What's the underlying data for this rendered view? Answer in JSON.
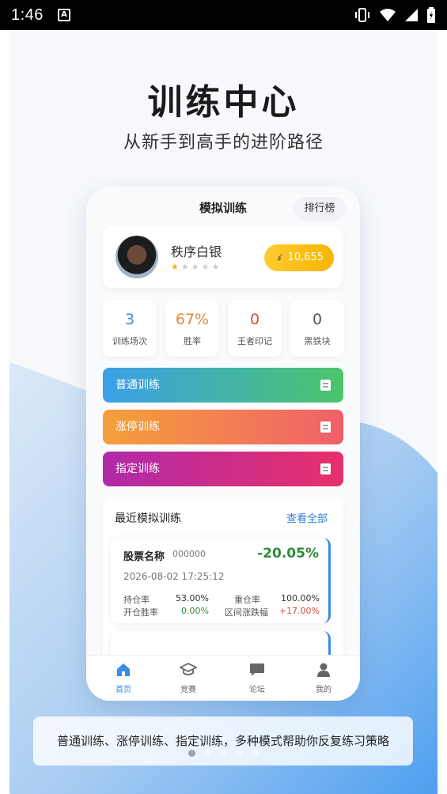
{
  "status_bar": {
    "time": "1:46",
    "notification_letter": "A"
  },
  "hero": {
    "title": "训练中心",
    "subtitle": "从新手到高手的进阶路径"
  },
  "phone": {
    "title": "模拟训练",
    "rank_button": "排行榜",
    "user": {
      "name": "秩序白银",
      "rating": 1,
      "rating_max": 5,
      "coins": "10,655"
    },
    "stats": [
      {
        "value": "3",
        "label": "训练场次",
        "color": "#3a8de0"
      },
      {
        "value": "67%",
        "label": "胜率",
        "color": "#e08a3a"
      },
      {
        "value": "0",
        "label": "王者印记",
        "color": "#e0483a"
      },
      {
        "value": "0",
        "label": "黑铁块",
        "color": "#555555"
      }
    ],
    "modes": [
      {
        "label": "普通训练",
        "gradient": [
          "#3aa0e8",
          "#4cc56a"
        ]
      },
      {
        "label": "涨停训练",
        "gradient": [
          "#f5a03a",
          "#f0606a"
        ]
      },
      {
        "label": "指定训练",
        "gradient": [
          "#b02aa8",
          "#e8306a"
        ]
      }
    ],
    "recent": {
      "title": "最近模拟训练",
      "view_all": "查看全部",
      "card": {
        "stock_name": "股票名称",
        "stock_code": "000000",
        "change": "-20.05%",
        "time": "2026-08-02 17:25:12",
        "metrics": [
          {
            "label": "持仓率",
            "value": "53.00%"
          },
          {
            "label": "重仓率",
            "value": "100.00%"
          },
          {
            "label": "开仓胜率",
            "value": "0.00%"
          },
          {
            "label": "区间涨跌幅",
            "value": "+17.00%"
          }
        ]
      }
    },
    "tabs": [
      {
        "label": "首页",
        "icon": "home-icon",
        "active": true
      },
      {
        "label": "竞赛",
        "icon": "graduation-cap-icon",
        "active": false
      },
      {
        "label": "论坛",
        "icon": "chat-icon",
        "active": false
      },
      {
        "label": "我的",
        "icon": "person-icon",
        "active": false
      }
    ]
  },
  "banner": {
    "text": "普通训练、涨停训练、指定训练，多种模式帮助你反复练习策略"
  },
  "pager": {
    "count": 5,
    "active_index": 0
  },
  "colors": {
    "accent": "#3a8de0",
    "wave_top": "#c9def5",
    "wave_bottom": "#5aa6ee"
  }
}
